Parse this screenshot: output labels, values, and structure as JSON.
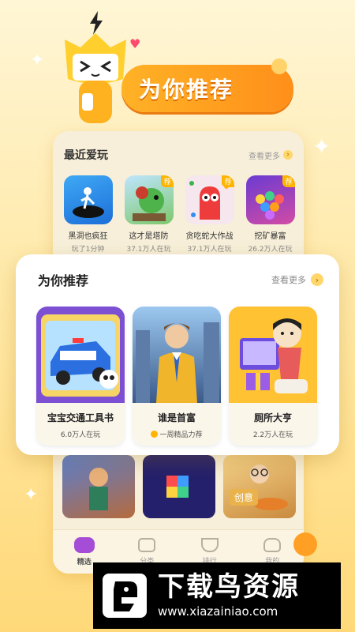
{
  "banner": {
    "title": "为你推荐"
  },
  "recent": {
    "title": "最近爱玩",
    "more": "查看更多",
    "items": [
      {
        "name": "黑洞也疯狂",
        "sub": "玩了1分钟",
        "tag": ""
      },
      {
        "name": "这才是塔防",
        "sub": "37.1万人在玩",
        "tag": "荐"
      },
      {
        "name": "贪吃蛇大作战",
        "sub": "37.1万人在玩",
        "tag": "荐"
      },
      {
        "name": "挖矿暴富",
        "sub": "26.2万人在玩",
        "tag": "荐"
      }
    ]
  },
  "recommend": {
    "title": "为你推荐",
    "more": "查看更多",
    "games": [
      {
        "name": "宝宝交通工具书",
        "sub": "6.0万人在玩"
      },
      {
        "name": "谁是首富",
        "sub": "一周精品力荐"
      },
      {
        "name": "厕所大亨",
        "sub": "2.2万人在玩"
      }
    ]
  },
  "below": {
    "items": [
      {
        "name": ""
      },
      {
        "name": ""
      },
      {
        "name": "创意"
      }
    ]
  },
  "tabs": [
    {
      "label": "精选",
      "active": true
    },
    {
      "label": "分类",
      "active": false
    },
    {
      "label": "排行",
      "active": false
    },
    {
      "label": "我的",
      "active": false
    }
  ],
  "watermark": {
    "title": "下载鸟资源",
    "url": "www.xiazainiao.com"
  },
  "colors": {
    "accent": "#ffa51f",
    "card_bg": "#ffffff",
    "page_bg": "#ffe9a8"
  }
}
